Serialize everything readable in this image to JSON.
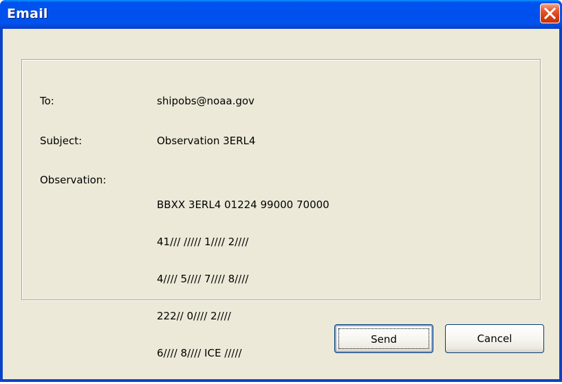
{
  "window": {
    "title": "Email",
    "close_icon": "close-icon"
  },
  "form": {
    "to_label": "To:",
    "to_value": "shipobs@noaa.gov",
    "subject_label": "Subject:",
    "subject_value": "Observation 3ERL4",
    "observation_label": "Observation:",
    "observation_lines": [
      "BBXX 3ERL4 01224 99000 70000",
      "41/// ///// 1//// 2////",
      "4//// 5//// 7//// 8////",
      "222// 0//// 2////",
      "6//// 8//// ICE /////"
    ]
  },
  "buttons": {
    "send_label": "Send",
    "cancel_label": "Cancel"
  },
  "colors": {
    "titlebar": "#0050ee",
    "client_background": "#ece9d8",
    "close_button": "#d63d13"
  }
}
